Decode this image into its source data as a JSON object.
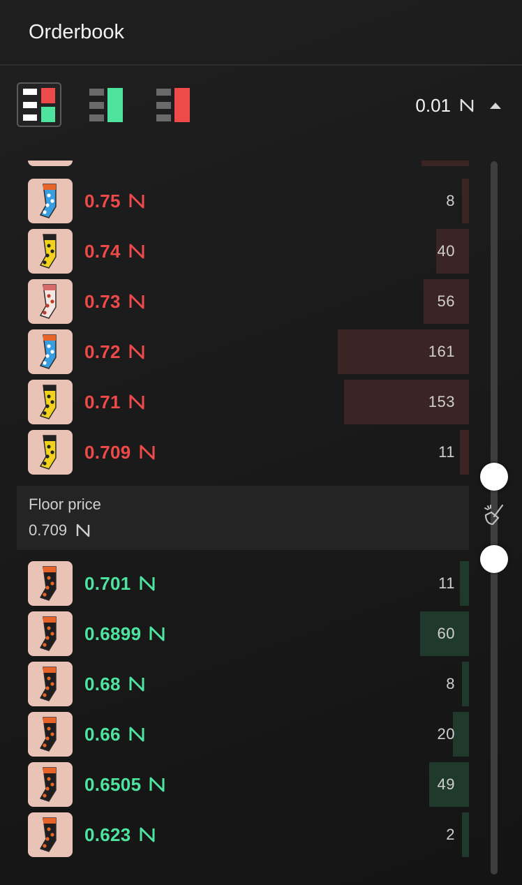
{
  "header": {
    "title": "Orderbook"
  },
  "toolbar": {
    "views": [
      {
        "name": "view-both-button",
        "active": true
      },
      {
        "name": "view-bids-button",
        "active": false
      },
      {
        "name": "view-asks-button",
        "active": false
      }
    ],
    "tick_size": "0.01"
  },
  "colors": {
    "ask": "#ee4a4a",
    "bid": "#4fe3a0",
    "ask_depth": "#3a2424",
    "bid_depth": "#1f3a2c",
    "thumb_bg": "#e9c3b5"
  },
  "asks": [
    {
      "price": "0.75",
      "qty": "8",
      "depth": 8,
      "sock": "blue-orange"
    },
    {
      "price": "0.74",
      "qty": "40",
      "depth": 40,
      "sock": "yellow-dots"
    },
    {
      "price": "0.73",
      "qty": "56",
      "depth": 56,
      "sock": "pink-white"
    },
    {
      "price": "0.72",
      "qty": "161",
      "depth": 161,
      "sock": "blue-orange"
    },
    {
      "price": "0.71",
      "qty": "153",
      "depth": 153,
      "sock": "yellow-dots"
    },
    {
      "price": "0.709",
      "qty": "11",
      "depth": 11,
      "sock": "yellow-dots"
    }
  ],
  "floor": {
    "label": "Floor price",
    "value": "0.709"
  },
  "bids": [
    {
      "price": "0.701",
      "qty": "11",
      "depth": 11,
      "sock": "orange-dots"
    },
    {
      "price": "0.6899",
      "qty": "60",
      "depth": 60,
      "sock": "orange-dots"
    },
    {
      "price": "0.68",
      "qty": "8",
      "depth": 8,
      "sock": "orange-dots"
    },
    {
      "price": "0.66",
      "qty": "20",
      "depth": 20,
      "sock": "orange-dots"
    },
    {
      "price": "0.6505",
      "qty": "49",
      "depth": 49,
      "sock": "orange-dots"
    },
    {
      "price": "0.623",
      "qty": "2",
      "depth": 2,
      "sock": "orange-dots"
    }
  ],
  "icons": {
    "currency": "near-icon",
    "clear": "broom-icon",
    "sort": "chevron-up-icon"
  }
}
